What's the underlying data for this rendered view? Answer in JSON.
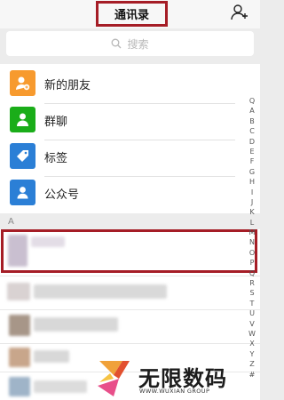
{
  "header": {
    "title": "通讯录",
    "add_icon": "add-friend-icon"
  },
  "search": {
    "placeholder": "搜索",
    "icon": "search-icon"
  },
  "functions": [
    {
      "label": "新的朋友",
      "icon": "new-friends-icon",
      "color": "#f79a2e"
    },
    {
      "label": "群聊",
      "icon": "group-chat-icon",
      "color": "#1aad19"
    },
    {
      "label": "标签",
      "icon": "tag-icon",
      "color": "#2b7fd6"
    },
    {
      "label": "公众号",
      "icon": "official-account-icon",
      "color": "#2b7fd6"
    }
  ],
  "section_header": "A",
  "index_letters": [
    "Q",
    "A",
    "B",
    "C",
    "D",
    "E",
    "F",
    "G",
    "H",
    "I",
    "J",
    "K",
    "L",
    "M",
    "N",
    "O",
    "P",
    "Q",
    "R",
    "S",
    "T",
    "U",
    "V",
    "W",
    "X",
    "Y",
    "Z",
    "#"
  ],
  "watermark": {
    "name": "无限数码",
    "sub": "WWW.WUXIAN GROUP"
  },
  "colors": {
    "highlight": "#a51d26",
    "background": "#ececec"
  }
}
